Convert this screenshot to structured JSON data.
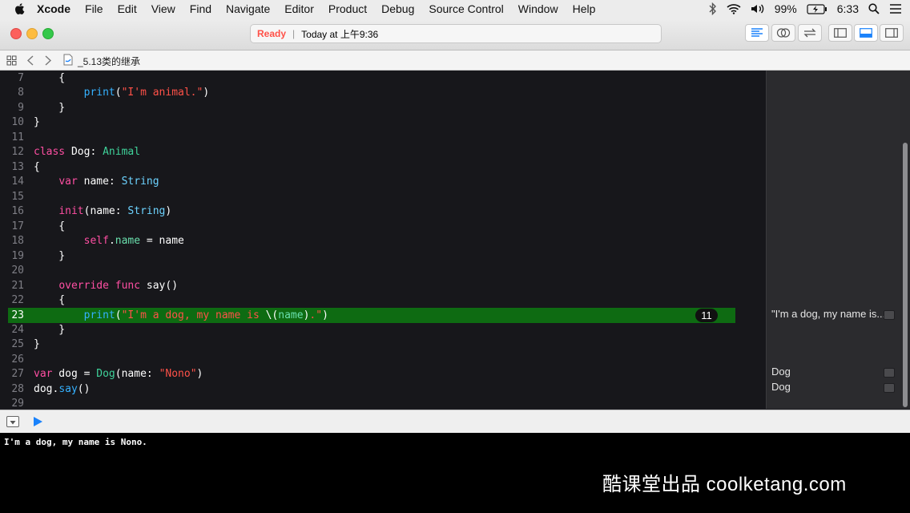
{
  "menubar": {
    "app": "Xcode",
    "items": [
      "File",
      "Edit",
      "View",
      "Find",
      "Navigate",
      "Editor",
      "Product",
      "Debug",
      "Source Control",
      "Window",
      "Help"
    ],
    "battery": "99%",
    "time": "6:33"
  },
  "toolbar": {
    "status": "Ready",
    "timestamp": "Today at 上午9:36"
  },
  "jumpbar": {
    "file_name": "_5.13类的继承"
  },
  "code_lines": [
    {
      "n": "7",
      "segs": [
        [
          "",
          "    {"
        ]
      ]
    },
    {
      "n": "8",
      "segs": [
        [
          "",
          "        "
        ],
        [
          "fn",
          "print"
        ],
        [
          "",
          "("
        ],
        [
          "st",
          "\"I'm animal.\""
        ],
        [
          "",
          ")"
        ]
      ]
    },
    {
      "n": "9",
      "segs": [
        [
          "",
          "    }"
        ]
      ]
    },
    {
      "n": "10",
      "segs": [
        [
          "",
          "}"
        ]
      ]
    },
    {
      "n": "11",
      "segs": []
    },
    {
      "n": "12",
      "segs": [
        [
          "kw",
          "class"
        ],
        [
          "",
          " Dog: "
        ],
        [
          "cl",
          "Animal"
        ]
      ]
    },
    {
      "n": "13",
      "segs": [
        [
          "",
          "{"
        ]
      ]
    },
    {
      "n": "14",
      "segs": [
        [
          "",
          "    "
        ],
        [
          "kw",
          "var"
        ],
        [
          "",
          " name: "
        ],
        [
          "ty",
          "String"
        ]
      ]
    },
    {
      "n": "15",
      "segs": []
    },
    {
      "n": "16",
      "segs": [
        [
          "",
          "    "
        ],
        [
          "kw",
          "init"
        ],
        [
          "",
          "(name: "
        ],
        [
          "ty",
          "String"
        ],
        [
          "",
          ")"
        ]
      ]
    },
    {
      "n": "17",
      "segs": [
        [
          "",
          "    {"
        ]
      ]
    },
    {
      "n": "18",
      "segs": [
        [
          "",
          "        "
        ],
        [
          "kw",
          "self"
        ],
        [
          "",
          "."
        ],
        [
          "pr",
          "name"
        ],
        [
          "",
          " = name"
        ]
      ]
    },
    {
      "n": "19",
      "segs": [
        [
          "",
          "    }"
        ]
      ]
    },
    {
      "n": "20",
      "segs": []
    },
    {
      "n": "21",
      "segs": [
        [
          "",
          "    "
        ],
        [
          "kw",
          "override"
        ],
        [
          "",
          " "
        ],
        [
          "kw",
          "func"
        ],
        [
          "",
          " say()"
        ]
      ]
    },
    {
      "n": "22",
      "segs": [
        [
          "",
          "    {"
        ]
      ]
    },
    {
      "n": "23",
      "segs": [
        [
          "",
          "        "
        ],
        [
          "fn",
          "print"
        ],
        [
          "",
          "("
        ],
        [
          "st",
          "\"I'm a dog, my name is "
        ],
        [
          "",
          "\\("
        ],
        [
          "pr",
          "name"
        ],
        [
          "",
          ")"
        ],
        [
          "st",
          ".\""
        ],
        [
          "",
          ")"
        ]
      ]
    },
    {
      "n": "24",
      "segs": [
        [
          "",
          "    }"
        ]
      ]
    },
    {
      "n": "25",
      "segs": [
        [
          "",
          "}"
        ]
      ]
    },
    {
      "n": "26",
      "segs": []
    },
    {
      "n": "27",
      "segs": [
        [
          "kw",
          "var"
        ],
        [
          "",
          " dog = "
        ],
        [
          "cl",
          "Dog"
        ],
        [
          "",
          "(name: "
        ],
        [
          "st",
          "\"Nono\""
        ],
        [
          "",
          ")"
        ]
      ]
    },
    {
      "n": "28",
      "segs": [
        [
          "",
          "dog."
        ],
        [
          "fn",
          "say"
        ],
        [
          "",
          "()"
        ]
      ]
    },
    {
      "n": "29",
      "segs": []
    }
  ],
  "highlight": {
    "line": "23",
    "badge": "11"
  },
  "results": [
    {
      "line": "23",
      "text": "\"I'm a dog, my name is..."
    },
    {
      "line": "27",
      "text": "Dog"
    },
    {
      "line": "28",
      "text": "Dog"
    }
  ],
  "console_output": "I'm a dog, my name is Nono.",
  "watermark": "酷课堂出品 coolketang.com",
  "colors": {
    "keyword": "#ff4fa3",
    "type": "#6dd3ff",
    "function": "#35b1ff",
    "string": "#ff5148",
    "property": "#6ae0ad",
    "class": "#3fd29a",
    "highlight": "#0e6b12",
    "accent": "#1a82fb"
  }
}
